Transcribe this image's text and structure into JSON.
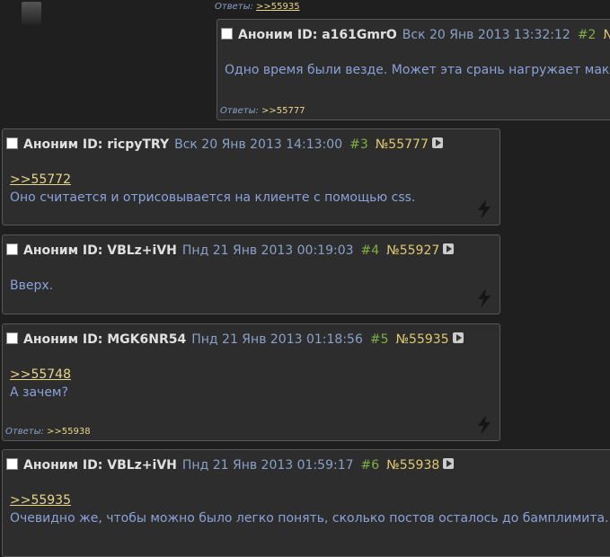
{
  "top": {
    "replies_label": "Ответы:",
    "replies_link": ">>55935"
  },
  "posts": [
    {
      "name": "Аноним ID: a161GmrO",
      "date": "Вск 20 Янв 2013 13:32:12",
      "num": "#2",
      "id": "№",
      "quote": "",
      "text": "Одно время были везде. Может эта срань нагружает мака",
      "replies_label": "Ответы:",
      "replies_link": ">>55777"
    },
    {
      "name": "Аноним ID: ricpyTRY",
      "date": "Вск 20 Янв 2013 14:13:00",
      "num": "#3",
      "id": "№55777",
      "quote": ">>55772",
      "text": "Оно считается и отрисовывается на клиенте с помощью css."
    },
    {
      "name": "Аноним ID: VBLz+iVH",
      "date": "Пнд 21 Янв 2013 00:19:03",
      "num": "#4",
      "id": "№55927",
      "quote": "",
      "text": "Вверх."
    },
    {
      "name": "Аноним ID: MGK6NR54",
      "date": "Пнд 21 Янв 2013 01:18:56",
      "num": "#5",
      "id": "№55935",
      "quote": ">>55748",
      "text": "А зачем?",
      "replies_label": "Ответы:",
      "replies_link": ">>55938"
    },
    {
      "name": "Аноним ID: VBLz+iVH",
      "date": "Пнд 21 Янв 2013 01:59:17",
      "num": "#6",
      "id": "№55938",
      "quote": ">>55935",
      "text": "Очевидно же, чтобы можно было легко понять, сколько постов осталось до бамплимита."
    }
  ]
}
